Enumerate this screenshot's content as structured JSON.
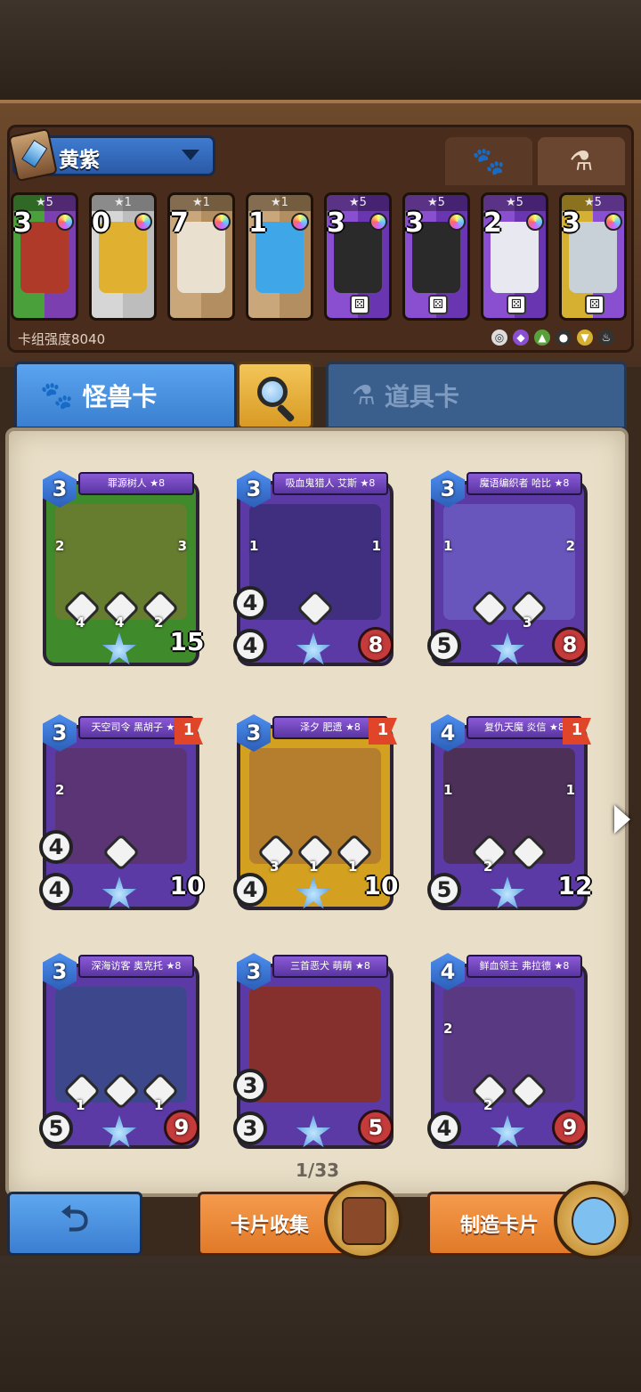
{
  "deck": {
    "name": "黄紫",
    "power_label": "卡组强度8040",
    "cards": [
      {
        "stars": "★5",
        "count": "3",
        "colors": [
          "#4aa03a",
          "#7b3fb0"
        ],
        "art": "#b03a2a"
      },
      {
        "stars": "★1",
        "count": "0",
        "colors": [
          "#d6d6d6",
          "#bdbdbd"
        ],
        "art": "#e0b030"
      },
      {
        "stars": "★1",
        "count": "7",
        "colors": [
          "#c9a77a",
          "#b28e60"
        ],
        "art": "#e9e0d0"
      },
      {
        "stars": "★1",
        "count": "1",
        "colors": [
          "#c9a77a",
          "#b28e60"
        ],
        "art": "#3fa6e8"
      },
      {
        "stars": "★5",
        "count": "3",
        "colors": [
          "#8a4fd0",
          "#6a35b0"
        ],
        "art": "#2a2a2a"
      },
      {
        "stars": "★5",
        "count": "3",
        "colors": [
          "#8a4fd0",
          "#6a35b0"
        ],
        "art": "#2a2a2a"
      },
      {
        "stars": "★5",
        "count": "2",
        "colors": [
          "#8a4fd0",
          "#6a35b0"
        ],
        "art": "#e8e8f0"
      },
      {
        "stars": "★5",
        "count": "3",
        "colors": [
          "#d6b030",
          "#8a4fd0"
        ],
        "art": "#c8d0d8"
      }
    ]
  },
  "tabs": {
    "monster": "怪兽卡",
    "items": "道具卡"
  },
  "cards": [
    {
      "name": "罪源树人 ★8",
      "cost": "3",
      "atk": "",
      "def": "",
      "hp": "15",
      "frame": "#3f8a2a",
      "art": "#6a7a30",
      "skills": [
        "4",
        "4",
        "2"
      ],
      "left": [
        "2"
      ],
      "right": [
        "3"
      ],
      "flag": ""
    },
    {
      "name": "吸血鬼猎人 艾斯 ★8",
      "cost": "3",
      "atk": "4",
      "def": "4",
      "hp": "8",
      "frame": "#5b3aa6",
      "art": "#3c2f7a",
      "skills": [
        ""
      ],
      "left": [
        "1"
      ],
      "right": [
        "1"
      ],
      "flag": ""
    },
    {
      "name": "魔语编织者 哈比 ★8",
      "cost": "3",
      "atk": "",
      "def": "5",
      "hp": "8",
      "frame": "#5b3aa6",
      "art": "#6a5ac0",
      "skills": [
        "",
        "3"
      ],
      "left": [
        "1"
      ],
      "right": [
        "2"
      ],
      "flag": ""
    },
    {
      "name": "天空司令 黑胡子 ★8",
      "cost": "3",
      "atk": "4",
      "def": "4",
      "hp": "10",
      "frame": "#5b3aa6",
      "art": "#5a3470",
      "skills": [
        ""
      ],
      "left": [
        "2"
      ],
      "right": [
        ""
      ],
      "flag": "1"
    },
    {
      "name": "泽夕 肥遗 ★8",
      "cost": "3",
      "atk": "",
      "def": "4",
      "hp": "10",
      "frame": "#d4a020",
      "art": "#b07a30",
      "skills": [
        "3",
        "1",
        "1"
      ],
      "left": [
        ""
      ],
      "right": [
        ""
      ],
      "flag": "1"
    },
    {
      "name": "复仇天魔 炎信 ★8",
      "cost": "4",
      "atk": "",
      "def": "5",
      "hp": "12",
      "frame": "#5b3aa6",
      "art": "#4a3050",
      "skills": [
        "2",
        ""
      ],
      "left": [
        "1"
      ],
      "right": [
        "1"
      ],
      "flag": "1"
    },
    {
      "name": "深海访客 奥克托 ★8",
      "cost": "3",
      "atk": "",
      "def": "5",
      "hp": "9",
      "frame": "#5b3aa6",
      "art": "#3a4a8a",
      "skills": [
        "1",
        "",
        "1"
      ],
      "left": [
        ""
      ],
      "right": [
        ""
      ],
      "flag": ""
    },
    {
      "name": "三首恶犬 萌萌 ★8",
      "cost": "3",
      "atk": "3",
      "def": "3",
      "hp": "5",
      "frame": "#5b3aa6",
      "art": "#8a3020",
      "skills": [],
      "left": [
        ""
      ],
      "right": [
        ""
      ],
      "flag": ""
    },
    {
      "name": "鲜血领主 弗拉德 ★8",
      "cost": "4",
      "atk": "",
      "def": "4",
      "hp": "9",
      "frame": "#5b3aa6",
      "art": "#5a3a80",
      "skills": [
        "2",
        ""
      ],
      "left": [
        "2"
      ],
      "right": [
        ""
      ],
      "flag": ""
    }
  ],
  "pager": "1/33",
  "buttons": {
    "collect": "卡片收集",
    "craft": "制造卡片"
  },
  "icons": {
    "pets_tab": "paw-icon",
    "items_tab": "potion-icon",
    "search": "search-icon",
    "back": "back-arrow-icon",
    "next": "chevron-right-icon"
  }
}
